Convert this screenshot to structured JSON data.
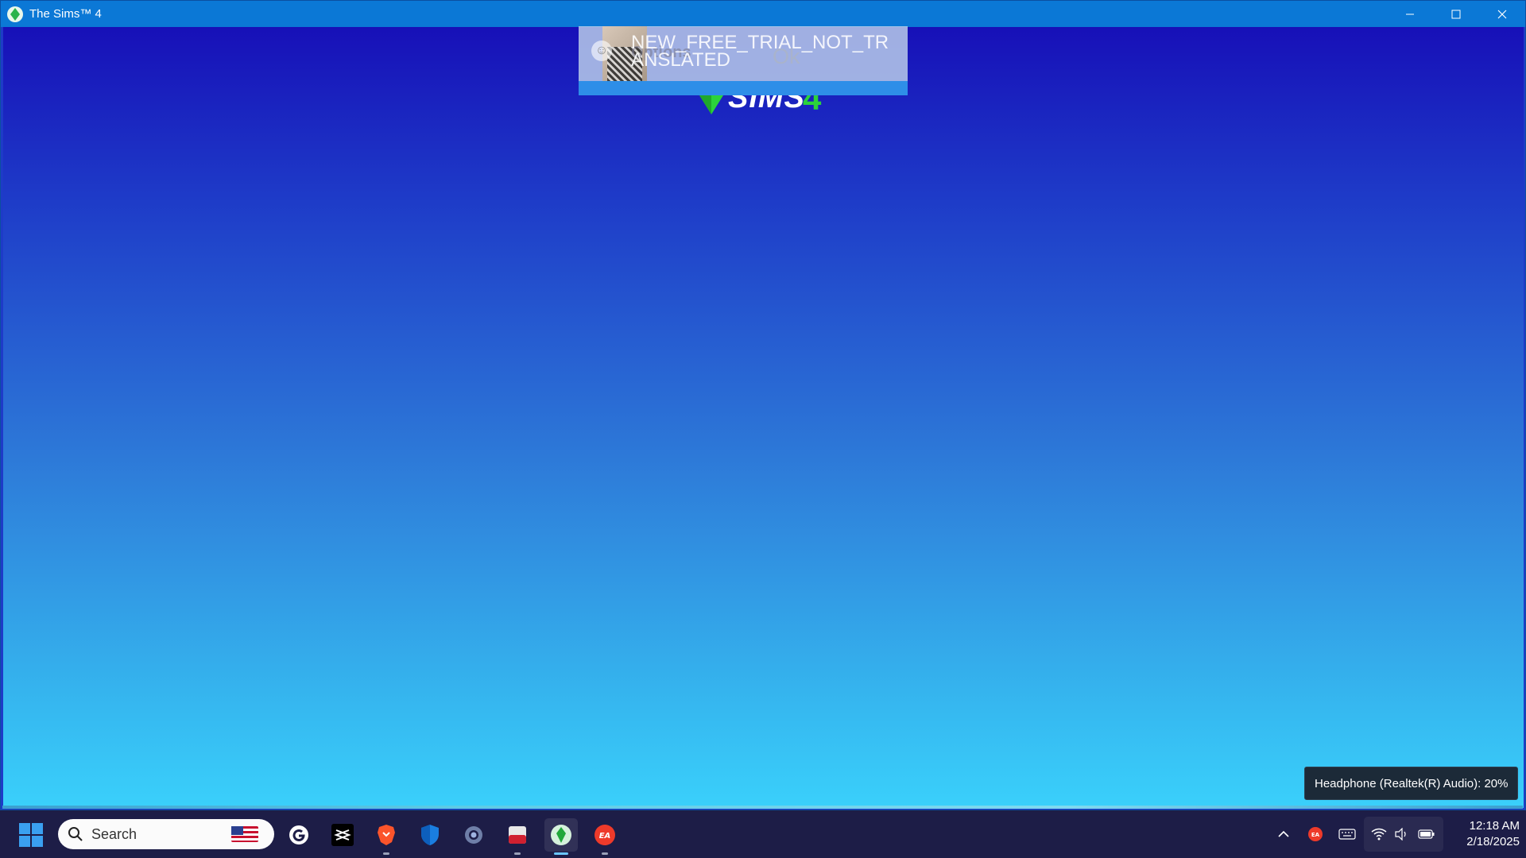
{
  "window": {
    "title": "The Sims™ 4",
    "controls": [
      "minimize",
      "maximize",
      "close"
    ]
  },
  "game": {
    "logo_word": "SIMS",
    "logo_number": "4",
    "notification": {
      "message": "NEW_FREE_TRIAL_NOT_TRANSLATED",
      "ghost_text": "Options",
      "ok_label": "Ok"
    }
  },
  "volume_tooltip": "Headphone (Realtek(R) Audio): 20%",
  "taskbar": {
    "search_placeholder": "Search",
    "apps": [
      {
        "name": "logitech-g-hub-icon"
      },
      {
        "name": "capcut-icon"
      },
      {
        "name": "brave-browser-icon"
      },
      {
        "name": "windows-security-icon"
      },
      {
        "name": "settings-icon"
      },
      {
        "name": "media-app-icon"
      },
      {
        "name": "sims4-icon"
      },
      {
        "name": "ea-app-icon"
      }
    ],
    "clock": {
      "time": "12:18 AM",
      "date": "2/18/2025"
    }
  },
  "colors": {
    "accent": "#0b78d6",
    "taskbar": "#1d1d47",
    "sims_green": "#2bd33b"
  }
}
